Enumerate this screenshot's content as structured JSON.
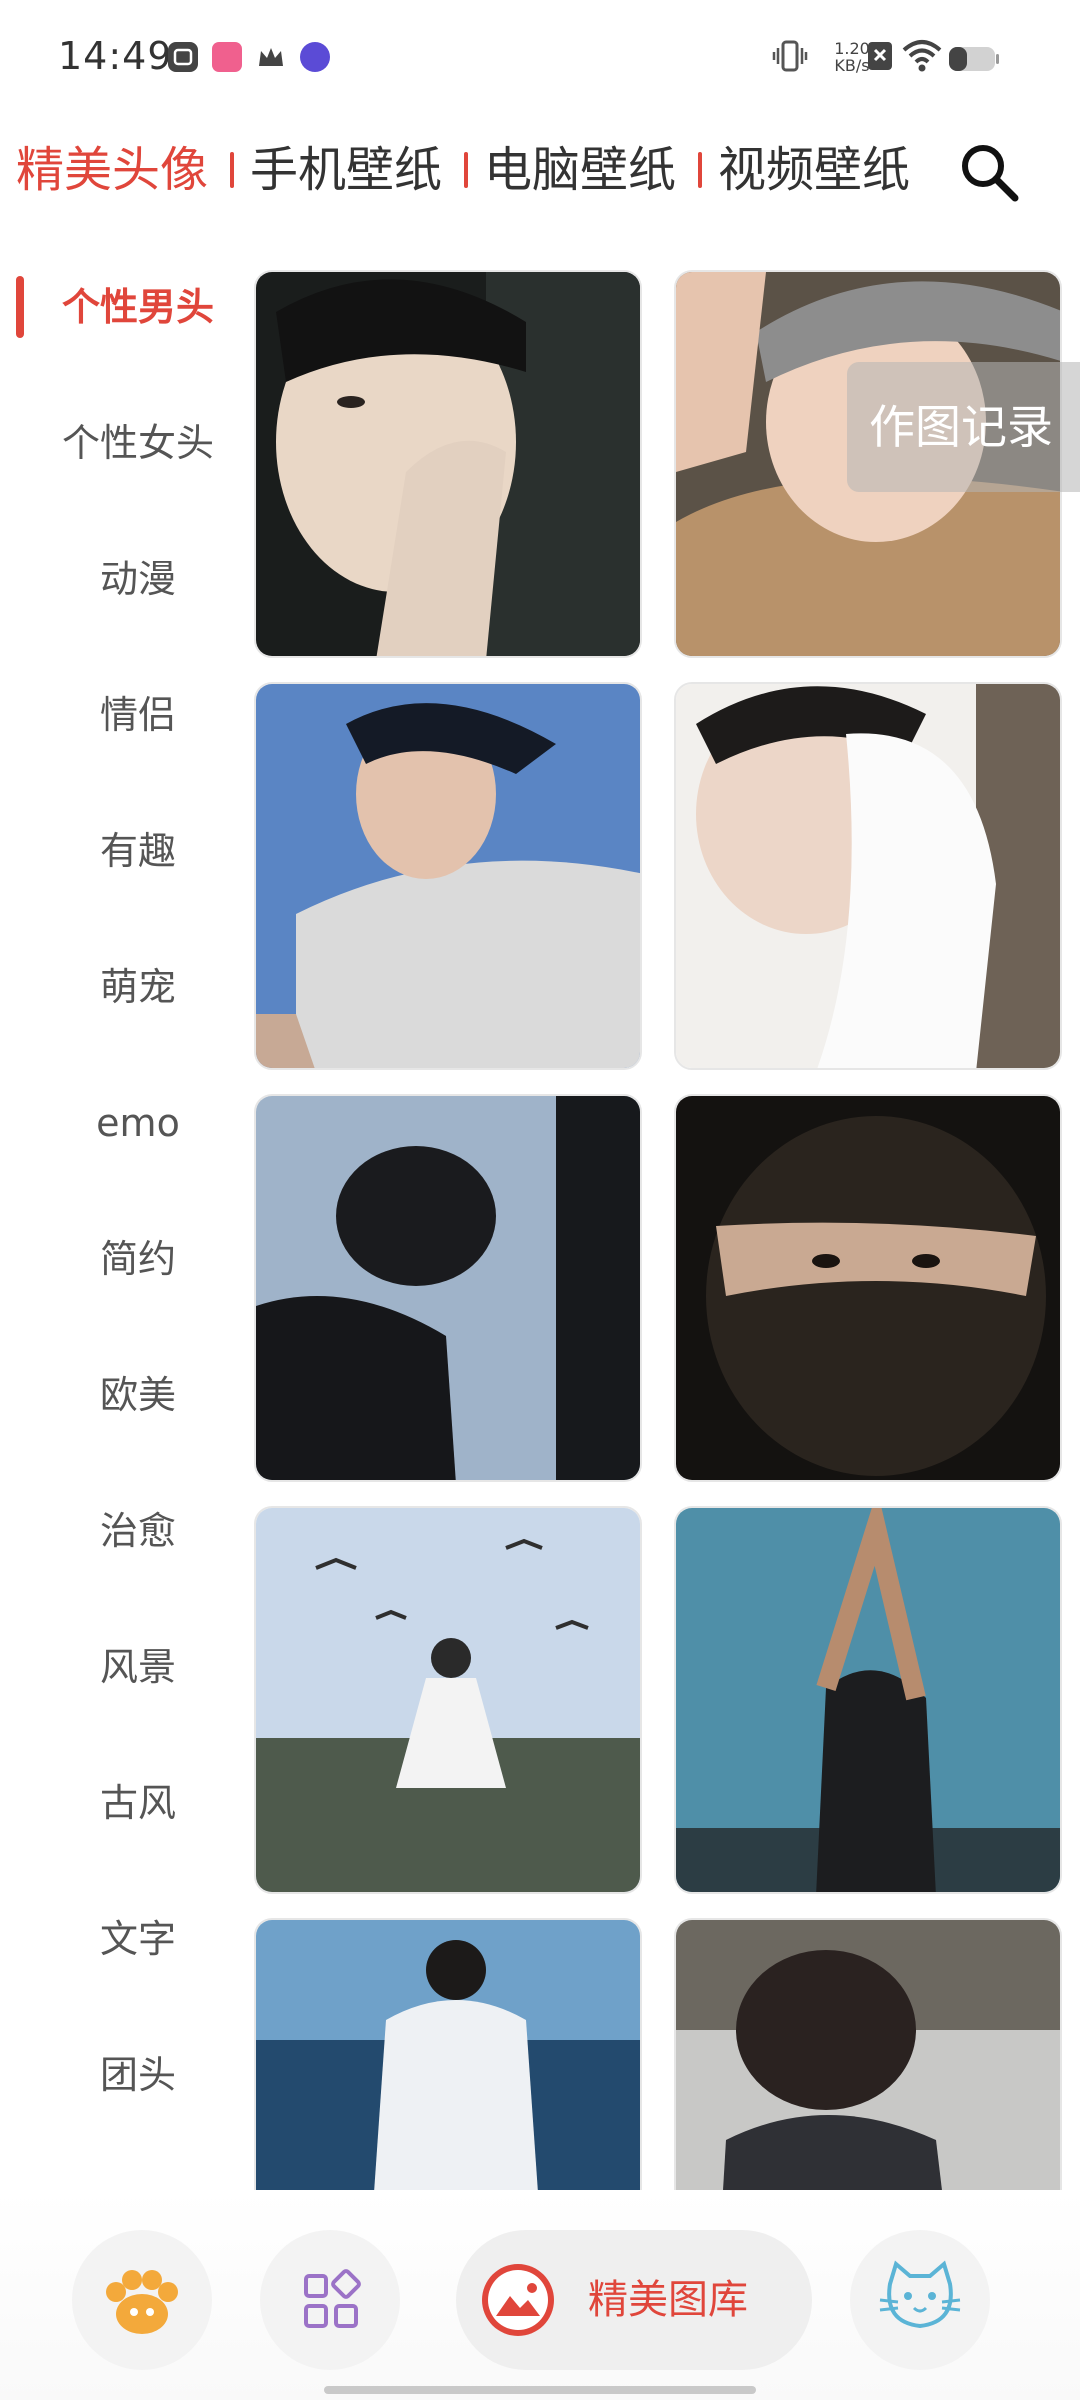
{
  "status_bar": {
    "time": "14:49",
    "network_speed_value": "1.20",
    "network_speed_unit": "KB/s",
    "battery_level": 0.4,
    "left_icons": [
      "app-icon-1",
      "bilibili-icon",
      "crown-icon",
      "tie-icon"
    ],
    "right_icons": [
      "vibrate-icon",
      "netspeed",
      "sim-off-icon",
      "wifi-icon",
      "battery-icon"
    ]
  },
  "top_tabs": [
    {
      "label": "精美头像",
      "active": true
    },
    {
      "label": "手机壁纸",
      "active": false
    },
    {
      "label": "电脑壁纸",
      "active": false
    },
    {
      "label": "视频壁纸",
      "active": false
    }
  ],
  "search_icon": "search-icon",
  "categories": [
    {
      "label": "个性男头",
      "active": true
    },
    {
      "label": "个性女头",
      "active": false
    },
    {
      "label": "动漫",
      "active": false
    },
    {
      "label": "情侣",
      "active": false
    },
    {
      "label": "有趣",
      "active": false
    },
    {
      "label": "萌宠",
      "active": false
    },
    {
      "label": "emo",
      "active": false
    },
    {
      "label": "简约",
      "active": false
    },
    {
      "label": "欧美",
      "active": false
    },
    {
      "label": "治愈",
      "active": false
    },
    {
      "label": "风景",
      "active": false
    },
    {
      "label": "古风",
      "active": false
    },
    {
      "label": "文字",
      "active": false
    },
    {
      "label": "团头",
      "active": false
    }
  ],
  "history_button": {
    "label": "作图记录"
  },
  "bottom_nav": {
    "items": [
      "paw-icon",
      "grid-icon",
      "gallery-icon",
      "cat-icon"
    ],
    "active_label": "精美图库"
  },
  "colors": {
    "accent": "#e0463b",
    "text": "#333333",
    "muted": "#555555",
    "nav_bg": "#efefef"
  }
}
